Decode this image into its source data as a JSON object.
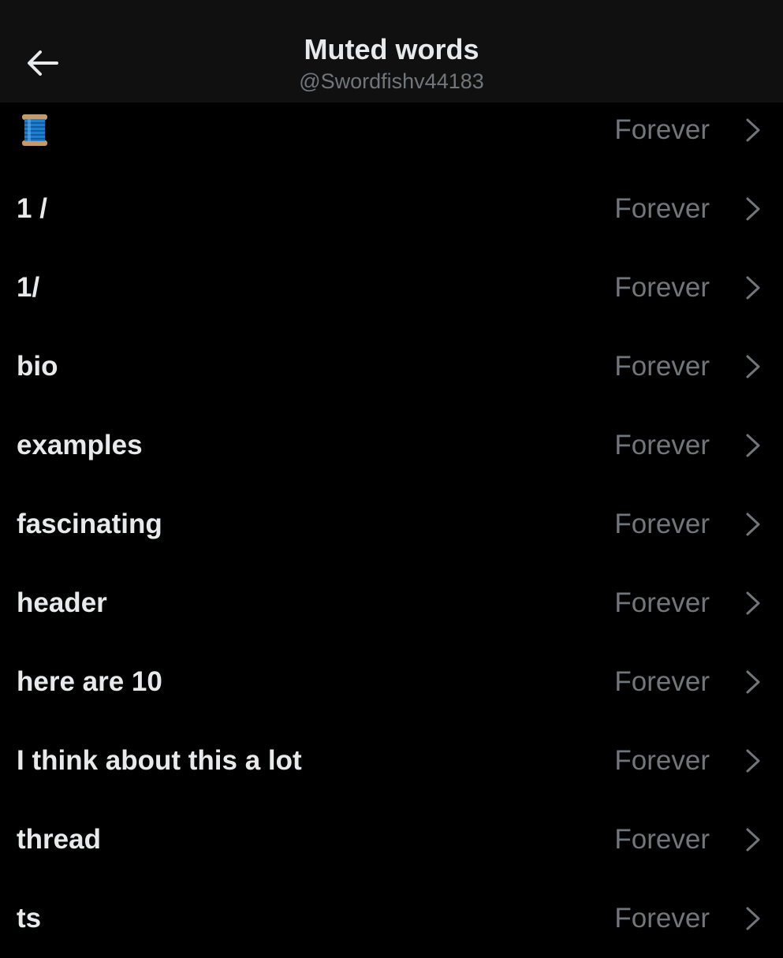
{
  "header": {
    "title": "Muted words",
    "handle": "@Swordfishv44183"
  },
  "muted_words": [
    {
      "word": "",
      "icon": "spool-of-thread-emoji",
      "duration": "Forever"
    },
    {
      "word": "1 /",
      "duration": "Forever"
    },
    {
      "word": "1/",
      "duration": "Forever"
    },
    {
      "word": "bio",
      "duration": "Forever"
    },
    {
      "word": "examples",
      "duration": "Forever"
    },
    {
      "word": "fascinating",
      "duration": "Forever"
    },
    {
      "word": "header",
      "duration": "Forever"
    },
    {
      "word": "here are 10",
      "duration": "Forever"
    },
    {
      "word": "I think about this a lot",
      "duration": "Forever"
    },
    {
      "word": "thread",
      "duration": "Forever"
    },
    {
      "word": "ts",
      "duration": "Forever"
    }
  ],
  "colors": {
    "background": "#000000",
    "header_background": "#101010",
    "primary_text": "#e7e9ea",
    "secondary_text": "#71767b",
    "spool_thread": "#1d7fd0"
  }
}
